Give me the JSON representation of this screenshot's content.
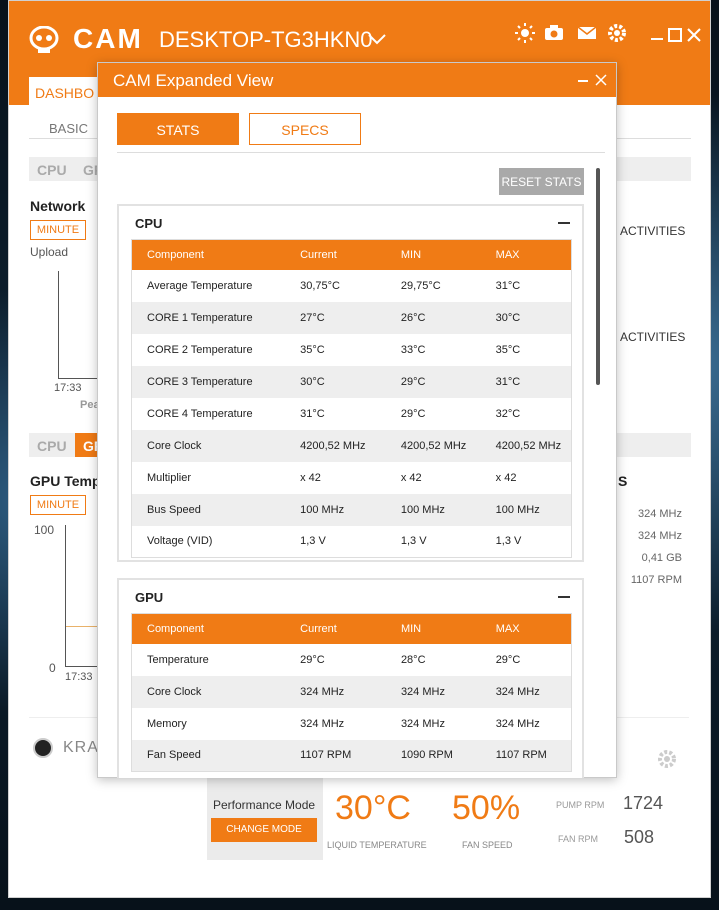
{
  "app": {
    "logo_text": "CAM",
    "device_name": "DESKTOP-TG3HKN0",
    "tab_dashboard": "DASHBO",
    "subtab_basic": "BASIC"
  },
  "background": {
    "seg1_cpu": "CPU",
    "seg1_gpu": "GP",
    "network_title": "Network",
    "minute": "MINUTE",
    "upload": "Upload",
    "time_1": "17:33",
    "peak": "Pea",
    "seg2_cpu": "CPU",
    "seg2_gpu": "GP",
    "gpu_title": "GPU Temp",
    "minute2": "MINUTE",
    "y_100": "100",
    "y_0": "0",
    "time_2": "17:33",
    "activities_1": "ACTIVITIES",
    "activities_2": "ACTIVITIES",
    "s_label": "S",
    "right_values": [
      "324 MHz",
      "324 MHz",
      "0,41 GB",
      "1107 RPM"
    ],
    "kraken": "KRA"
  },
  "bottom": {
    "performance_mode": "Performance Mode",
    "change_mode": "CHANGE MODE",
    "liquid_temp_value": "30°C",
    "liquid_temp_label": "LIQUID TEMPERATURE",
    "fan_speed_value": "50%",
    "fan_speed_label": "FAN SPEED",
    "pump_rpm_label": "PUMP RPM",
    "pump_rpm_value": "1724",
    "fan_rpm_label": "FAN RPM",
    "fan_rpm_value": "508"
  },
  "modal": {
    "title": "CAM Expanded View",
    "tab_stats": "STATS",
    "tab_specs": "SPECS",
    "reset_stats": "RESET STATS",
    "columns": [
      "Component",
      "Current",
      "MIN",
      "MAX"
    ],
    "cpu": {
      "title": "CPU",
      "rows": [
        [
          "Average Temperature",
          "30,75°C",
          "29,75°C",
          "31°C"
        ],
        [
          "CORE 1 Temperature",
          "27°C",
          "26°C",
          "30°C"
        ],
        [
          "CORE 2 Temperature",
          "35°C",
          "33°C",
          "35°C"
        ],
        [
          "CORE 3 Temperature",
          "30°C",
          "29°C",
          "31°C"
        ],
        [
          "CORE 4 Temperature",
          "31°C",
          "29°C",
          "32°C"
        ],
        [
          "Core Clock",
          "4200,52 MHz",
          "4200,52 MHz",
          "4200,52 MHz"
        ],
        [
          "Multiplier",
          "x 42",
          "x 42",
          "x 42"
        ],
        [
          "Bus Speed",
          "100 MHz",
          "100 MHz",
          "100 MHz"
        ],
        [
          "Voltage (VID)",
          "1,3 V",
          "1,3 V",
          "1,3 V"
        ]
      ]
    },
    "gpu": {
      "title": "GPU",
      "rows": [
        [
          "Temperature",
          "29°C",
          "28°C",
          "29°C"
        ],
        [
          "Core Clock",
          "324 MHz",
          "324 MHz",
          "324 MHz"
        ],
        [
          "Memory",
          "324 MHz",
          "324 MHz",
          "324 MHz"
        ],
        [
          "Fan Speed",
          "1107 RPM",
          "1090 RPM",
          "1107 RPM"
        ]
      ]
    }
  },
  "colors": {
    "accent": "#f07b15",
    "row_alt": "#eeeeee",
    "reset_button": "#a9a9a9"
  },
  "icons": {
    "logo": "nzxt-skull-icon",
    "header": [
      "brightness-icon",
      "camera-icon",
      "mail-icon",
      "gear-icon"
    ],
    "window": [
      "minimize-icon",
      "maximize-icon",
      "close-icon"
    ]
  }
}
